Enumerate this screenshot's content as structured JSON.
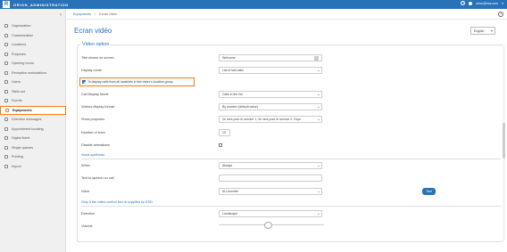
{
  "app": {
    "logo_letter": "R",
    "brand": "ORION_ADMINISTRATION",
    "user_email": "orion@ess.com",
    "help_symbol": "?",
    "user_menu_chevron": "▾"
  },
  "breadcrumb": {
    "parent": "Equipments",
    "separator": "/",
    "current": "Ecran vidéo"
  },
  "sidebar": {
    "collapse_symbol": "‹",
    "items": [
      {
        "label": "Organization",
        "icon": "building-icon",
        "active": false
      },
      {
        "label": "Customization",
        "icon": "brush-icon",
        "active": false
      },
      {
        "label": "Locations",
        "icon": "pin-icon",
        "active": false
      },
      {
        "label": "Purposes",
        "icon": "list-icon",
        "active": false
      },
      {
        "label": "Opening hours",
        "icon": "clock-icon",
        "active": false
      },
      {
        "label": "Reception workstations",
        "icon": "desk-icon",
        "active": false
      },
      {
        "label": "Users",
        "icon": "user-icon",
        "active": false
      },
      {
        "label": "Skills set",
        "icon": "skills-icon",
        "active": false
      },
      {
        "label": "Events",
        "icon": "calendar-icon",
        "active": false
      },
      {
        "label": "Equipments",
        "icon": "equipment-icon",
        "active": true
      },
      {
        "label": "Direction messages",
        "icon": "message-icon",
        "active": false
      },
      {
        "label": "Appointment booking",
        "icon": "booking-icon",
        "active": false
      },
      {
        "label": "Digital ticket",
        "icon": "ticket-icon",
        "active": false
      },
      {
        "label": "Single queues",
        "icon": "queue-icon",
        "active": false
      },
      {
        "label": "Printing",
        "icon": "printer-icon",
        "active": false
      },
      {
        "label": "Import",
        "icon": "import-icon",
        "active": false
      }
    ]
  },
  "page": {
    "title": "Ecran vidéo",
    "language": "English",
    "help": "?"
  },
  "form": {
    "section_title": "Video option",
    "title_label": "Title shown on screen",
    "title_value": "Welcome",
    "display_mode_label": "Display mode",
    "display_mode_value": "List of last calls",
    "all_locations_label": "To display calls from all locations in this video's location group",
    "call_display_mode_label": "Call Display Mode",
    "call_display_mode_value": "Calls in the list",
    "visitors_format_label": "Visitors display format",
    "visitors_format_value": "By number (default value)",
    "show_purposes_label": "Show purposes",
    "show_purposes_value": "2e vers pour le service 1, 2e vers pour le service 2, Expo",
    "number_of_lines_label": "Number of lines",
    "number_of_lines_value": "15",
    "disable_animations_label": "Disable animations",
    "vocal_section": "Vocal synthesis",
    "when_label": "When",
    "when_value": "Always",
    "tts_label": "Text to speech on call",
    "tts_value": "",
    "voice_label": "Voice",
    "voice_value": "AU-Annette",
    "test_button": "Test",
    "esd_section": "Only if the video control box is supplied by ESD",
    "direction_label": "Direction",
    "direction_value": "Landscape",
    "volume_label": "Volume",
    "volume_level": 0.47
  }
}
